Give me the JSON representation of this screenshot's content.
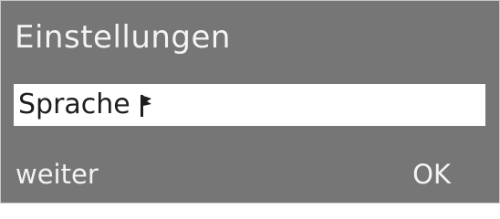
{
  "screen": {
    "title": "Einstellungen",
    "background_color": "#767676",
    "text_color": "#f4f4f4"
  },
  "menu": {
    "selected_item": {
      "label": "Sprache",
      "icon": "flag-icon",
      "highlight_color": "#ffffff"
    }
  },
  "softkeys": {
    "left_label": "weiter",
    "right_label": "OK"
  }
}
